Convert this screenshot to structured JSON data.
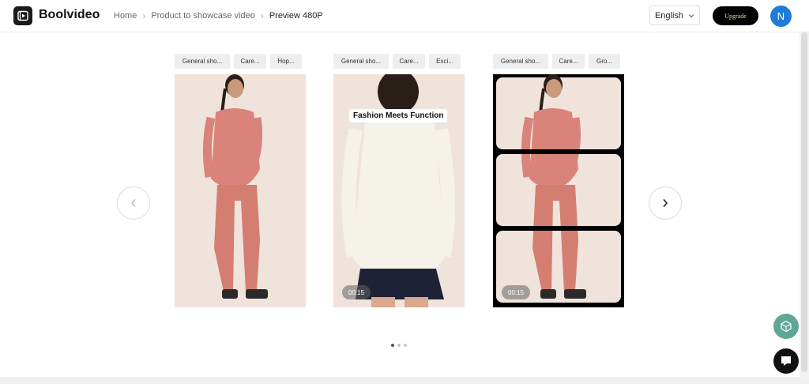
{
  "app": {
    "brand": "Boolvideo",
    "logo_icon": "video-frame-icon"
  },
  "breadcrumb": {
    "items": [
      "Home",
      "Product to showcase video",
      "Preview 480P"
    ]
  },
  "header": {
    "language": "English",
    "upgrade_label": "Upgrade",
    "avatar_initial": "N"
  },
  "carousel": {
    "prev_icon": "chevron-left-icon",
    "next_icon": "chevron-right-icon",
    "cards": [
      {
        "tags": [
          "General sho...",
          "Care...",
          "Hop..."
        ],
        "duration": ""
      },
      {
        "tags": [
          "General sho...",
          "Care...",
          "Exci..."
        ],
        "caption": "Fashion Meets Function",
        "duration": "00:15"
      },
      {
        "tags": [
          "General sho...",
          "Care...",
          "Gro..."
        ],
        "duration": "00:15"
      }
    ],
    "pagination": {
      "total": 3,
      "active": 1
    }
  },
  "colors": {
    "accent": "#1e7bd8",
    "upgrade_bg": "#000000",
    "upgrade_text": "#e9d9a8",
    "fab_teal": "#5fa795"
  },
  "fabs": {
    "assistant_icon": "cube-icon",
    "chat_icon": "chat-bubble-icon"
  }
}
